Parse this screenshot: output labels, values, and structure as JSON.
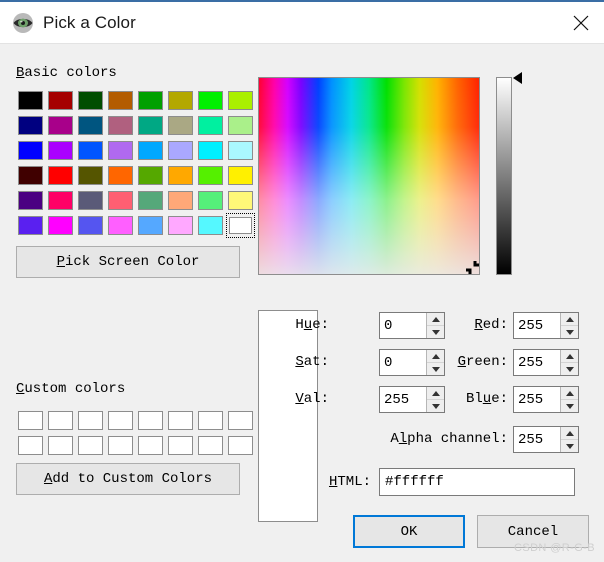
{
  "window": {
    "title": "Pick a Color",
    "icon": "eye-icon",
    "close_icon": "close-icon"
  },
  "basic_colors": {
    "label_prefix": "B",
    "label_rest": "asic colors",
    "rows": [
      [
        "#000000",
        "#a50000",
        "#004d00",
        "#b35c00",
        "#00a000",
        "#b3a800",
        "#00f000",
        "#aaf000"
      ],
      [
        "#000080",
        "#a8008a",
        "#005580",
        "#b0607f",
        "#00a884",
        "#aaa884",
        "#00f0a0",
        "#aaf08a"
      ],
      [
        "#0000ff",
        "#aa00ff",
        "#0055ff",
        "#b069f0",
        "#00a8ff",
        "#aaa8ff",
        "#00f0ff",
        "#aaf8ff"
      ],
      [
        "#400000",
        "#ff0000",
        "#555500",
        "#ff6600",
        "#55a800",
        "#ffa800",
        "#55f000",
        "#fff000"
      ],
      [
        "#4b0082",
        "#ff0066",
        "#5a5a78",
        "#ff5f72",
        "#55a87a",
        "#ffa878",
        "#55f07a",
        "#fff878"
      ],
      [
        "#5a20f0",
        "#ff00ff",
        "#5555f0",
        "#ff5fff",
        "#55a8ff",
        "#ffa8ff",
        "#55f8ff",
        "#ffffff"
      ]
    ],
    "selected_row": 5,
    "selected_col": 7
  },
  "pick_screen_button": {
    "label_prefix": "P",
    "label_rest": "ick Screen Color"
  },
  "custom_colors": {
    "label_prefix": "C",
    "label_rest": "ustom colors",
    "rows": [
      [
        "",
        "",
        "",
        "",
        "",
        "",
        "",
        ""
      ],
      [
        "",
        "",
        "",
        "",
        "",
        "",
        "",
        ""
      ]
    ]
  },
  "add_custom_button": {
    "label_prefix": "A",
    "label_rest": "dd to Custom Colors"
  },
  "color_field": {
    "name": "hue-saturation-field",
    "cursor_position": "bottom-right"
  },
  "value_slider": {
    "name": "value-slider",
    "marker_position": "top"
  },
  "preview": {
    "color": "#ffffff"
  },
  "fields": {
    "hue": {
      "label_a": "H",
      "label_u": "u",
      "label_b": "e:",
      "value": "0"
    },
    "sat": {
      "label_a": "",
      "label_u": "S",
      "label_b": "at:",
      "value": "0"
    },
    "val": {
      "label_a": "",
      "label_u": "V",
      "label_b": "al:",
      "value": "255"
    },
    "red": {
      "label_a": "",
      "label_u": "R",
      "label_b": "ed:",
      "value": "255"
    },
    "green": {
      "label_a": "",
      "label_u": "G",
      "label_b": "reen:",
      "value": "255"
    },
    "blue": {
      "label_a": "Bl",
      "label_u": "u",
      "label_b": "e:",
      "value": "255"
    },
    "alpha": {
      "label_a": "A",
      "label_u": "l",
      "label_b": "pha channel:",
      "value": "255"
    },
    "html": {
      "label_a": "",
      "label_u": "H",
      "label_b": "TML:",
      "value": "#ffffff"
    }
  },
  "buttons": {
    "ok": "OK",
    "cancel": "Cancel"
  },
  "watermark": "CSDN @R-G-B",
  "colors": {
    "accent": "#0078d7",
    "dialog_bg": "#f0f0f0",
    "titlebar_bg": "#ffffff"
  }
}
